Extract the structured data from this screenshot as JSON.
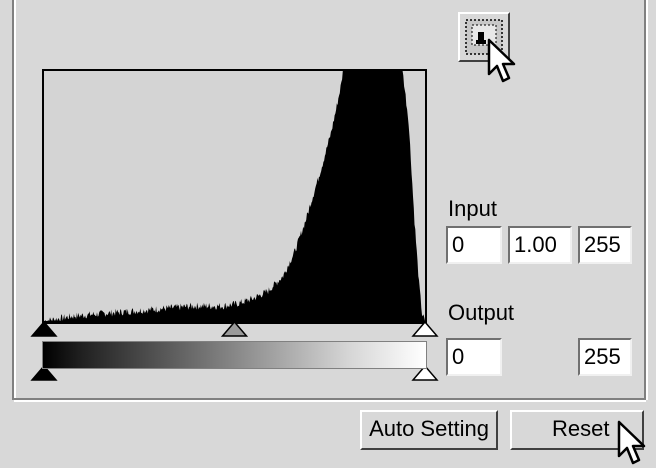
{
  "dialog": {
    "input_label": "Input",
    "output_label": "Output",
    "input_black": "0",
    "input_gamma": "1.00",
    "input_white": "255",
    "output_black": "0",
    "output_white": "255",
    "auto_setting_label": "Auto Setting",
    "reset_label": "Reset"
  },
  "icons": {
    "tool_button_icon": "eyedropper-set-point-icon",
    "cursor_icon": "arrow-cursor-icon"
  },
  "colors": {
    "panel_bg": "#d8d8d8",
    "histogram_bg": "#d4d4d4",
    "histogram_fill": "#000000"
  },
  "chart_data": {
    "type": "area",
    "x_range": [
      0,
      255
    ],
    "input_levels": {
      "black": 0,
      "gamma": 1.0,
      "white": 255
    },
    "output_levels": {
      "black": 0,
      "white": 255
    },
    "profile": [
      [
        0,
        0.0
      ],
      [
        10,
        0.01
      ],
      [
        20,
        0.02
      ],
      [
        40,
        0.03
      ],
      [
        60,
        0.04
      ],
      [
        80,
        0.05
      ],
      [
        100,
        0.06
      ],
      [
        120,
        0.06
      ],
      [
        130,
        0.07
      ],
      [
        140,
        0.09
      ],
      [
        150,
        0.12
      ],
      [
        160,
        0.18
      ],
      [
        168,
        0.28
      ],
      [
        175,
        0.4
      ],
      [
        180,
        0.5
      ],
      [
        186,
        0.62
      ],
      [
        192,
        0.75
      ],
      [
        196,
        0.86
      ],
      [
        199,
        0.95
      ],
      [
        200,
        1.0
      ],
      [
        230,
        1.0
      ],
      [
        240,
        1.0
      ],
      [
        244,
        0.8
      ],
      [
        248,
        0.4
      ],
      [
        251,
        0.15
      ],
      [
        253,
        0.03
      ],
      [
        255,
        0.0
      ]
    ]
  }
}
